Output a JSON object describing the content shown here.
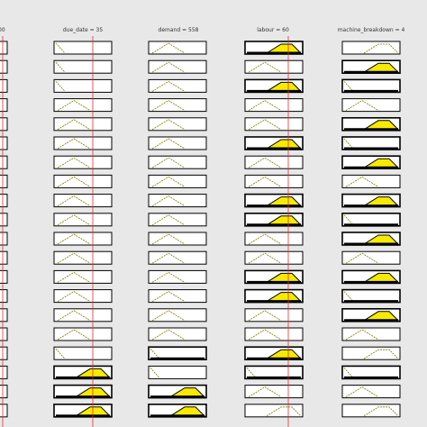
{
  "columns": [
    {
      "label": "00"
    },
    {
      "label": "due_date = 35"
    },
    {
      "label": "demand = 558"
    },
    {
      "label": "labour = 60"
    },
    {
      "label": "machine_breakdown = 4"
    }
  ],
  "rules": [
    [
      1,
      0,
      2,
      2
    ],
    [
      1,
      0,
      0,
      2
    ],
    [
      1,
      0,
      2,
      1
    ],
    [
      0,
      0,
      0,
      0
    ],
    [
      0,
      0,
      0,
      2
    ],
    [
      0,
      0,
      2,
      1
    ],
    [
      0,
      0,
      0,
      2
    ],
    [
      0,
      0,
      0,
      0
    ],
    [
      0,
      0,
      2,
      2
    ],
    [
      0,
      0,
      2,
      1
    ],
    [
      0,
      0,
      0,
      2
    ],
    [
      0,
      0,
      0,
      0
    ],
    [
      0,
      0,
      2,
      2
    ],
    [
      0,
      0,
      2,
      1
    ],
    [
      0,
      0,
      0,
      2
    ],
    [
      0,
      0,
      0,
      0
    ],
    [
      1,
      1,
      2,
      2
    ],
    [
      2,
      1,
      1,
      1
    ],
    [
      2,
      2,
      0,
      0
    ],
    [
      2,
      2,
      2,
      2
    ]
  ],
  "active": [
    [
      0,
      0,
      1,
      0
    ],
    [
      0,
      0,
      0,
      1
    ],
    [
      0,
      0,
      1,
      1
    ],
    [
      0,
      0,
      0,
      0
    ],
    [
      0,
      0,
      0,
      1
    ],
    [
      0,
      0,
      1,
      1
    ],
    [
      0,
      0,
      0,
      1
    ],
    [
      0,
      0,
      0,
      0
    ],
    [
      0,
      0,
      1,
      1
    ],
    [
      0,
      0,
      1,
      1
    ],
    [
      0,
      0,
      0,
      1
    ],
    [
      0,
      0,
      0,
      0
    ],
    [
      0,
      0,
      1,
      1
    ],
    [
      0,
      0,
      1,
      1
    ],
    [
      0,
      0,
      0,
      1
    ],
    [
      0,
      0,
      0,
      0
    ],
    [
      0,
      1,
      1,
      0
    ],
    [
      1,
      0,
      1,
      1
    ],
    [
      1,
      1,
      0,
      0
    ],
    [
      1,
      1,
      0,
      0
    ]
  ],
  "colors": {
    "fill": "#f7ea00",
    "curve": "#7a7a00",
    "marker": "#e03030",
    "frame": "#000000"
  }
}
